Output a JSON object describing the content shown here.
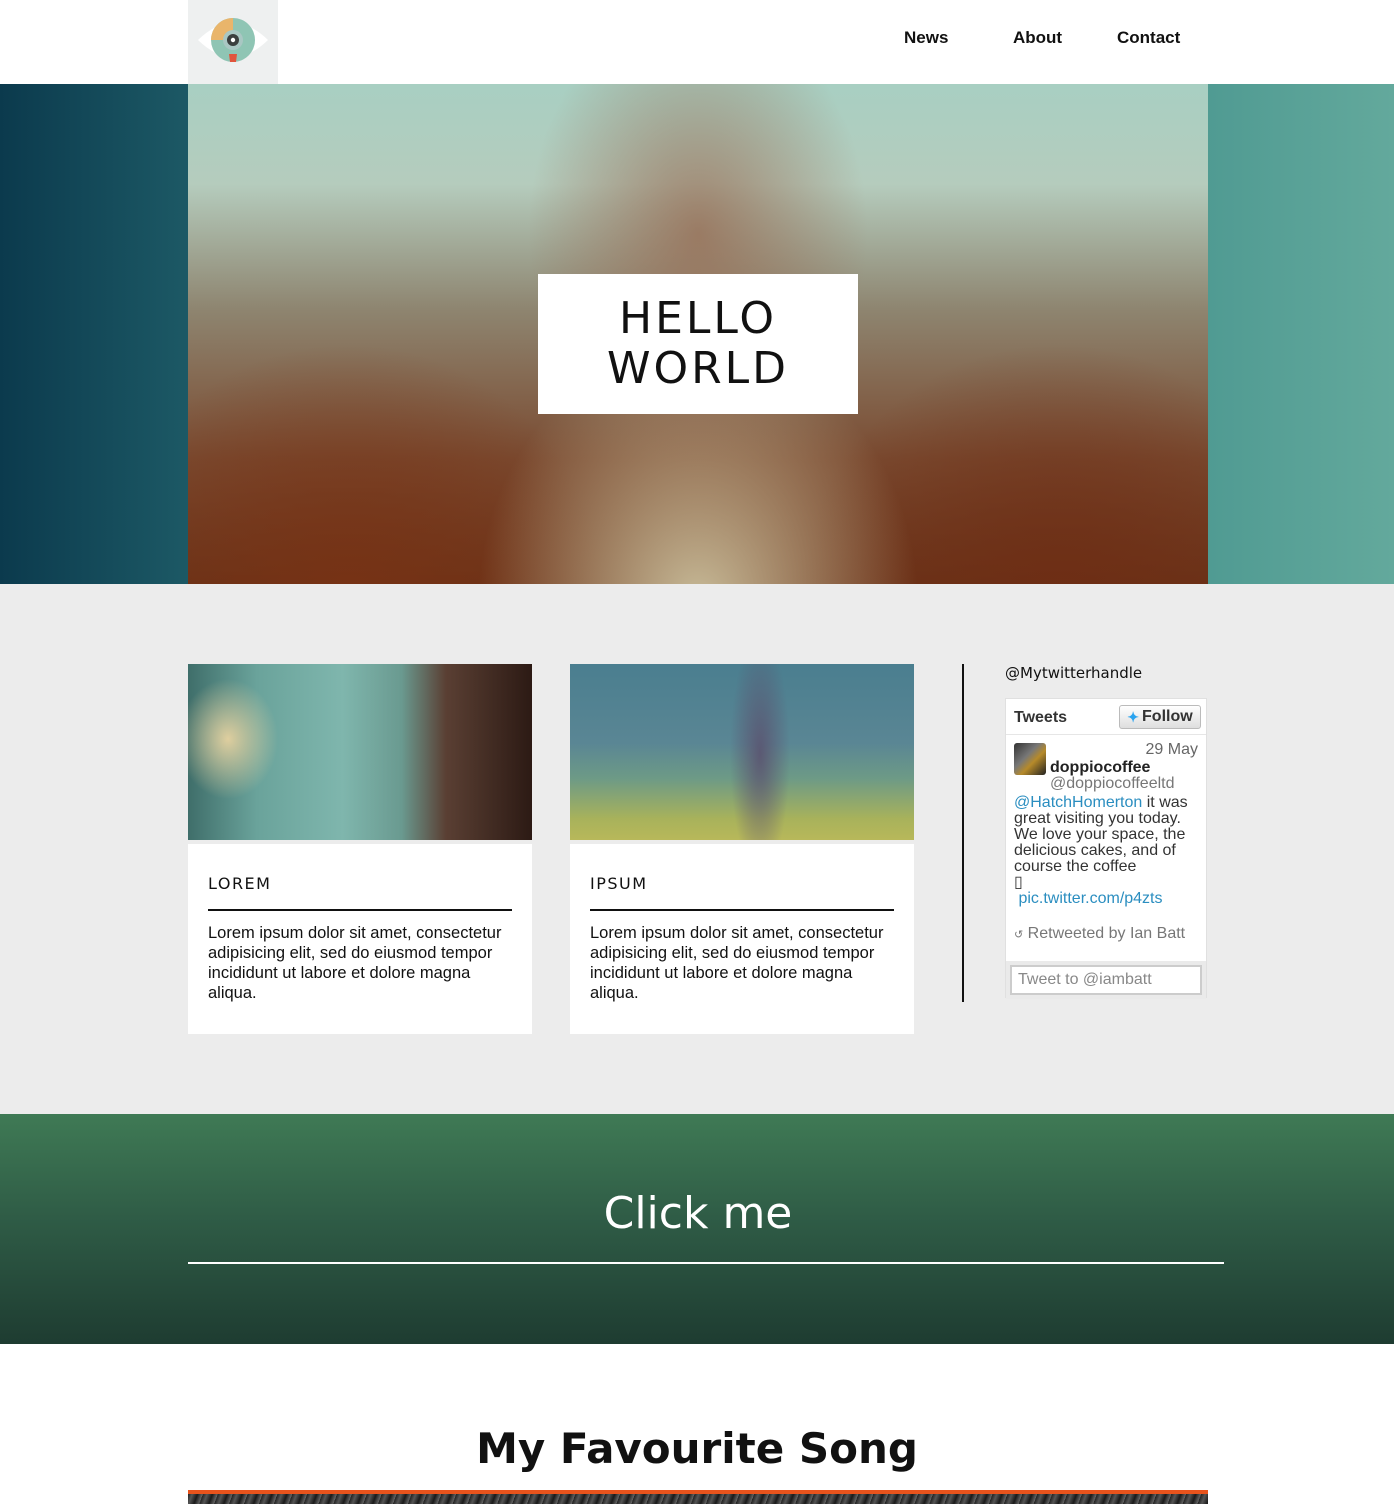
{
  "nav": {
    "links": [
      "News",
      "About",
      "Contact"
    ]
  },
  "hero": {
    "title": "HELLO WORLD"
  },
  "cards": [
    {
      "title": "LOREM",
      "text": "Lorem ipsum dolor sit amet, consectetur adipisicing elit, sed do eiusmod tempor incididunt ut labore et dolore magna aliqua."
    },
    {
      "title": "IPSUM",
      "text": "Lorem ipsum dolor sit amet, consectetur adipisicing elit, sed do eiusmod tempor incididunt ut labore et dolore magna aliqua."
    }
  ],
  "twitter": {
    "handle": "@Mytwitterhandle",
    "widget_title": "Tweets",
    "follow_label": "Follow",
    "tweet": {
      "date": "29 May",
      "name": "doppiocoffee",
      "screen_name": "@doppiocoffeeltd",
      "mention": "@HatchHomerton",
      "text": " it was great visiting you today. We love your space, the delicious cakes, and of course the coffee",
      "glyph": "▯",
      "link": "pic.twitter.com/p4zts",
      "retweeted_by": "Retweeted by Ian Batt"
    },
    "input_placeholder": "Tweet to @iambatt"
  },
  "cta": {
    "label": "Click me"
  },
  "song": {
    "title": "My Favourite Song"
  },
  "colors": {
    "accent_orange": "#e8531c",
    "link_blue": "#2b8ec0",
    "cta_green": "#2f5c46"
  }
}
